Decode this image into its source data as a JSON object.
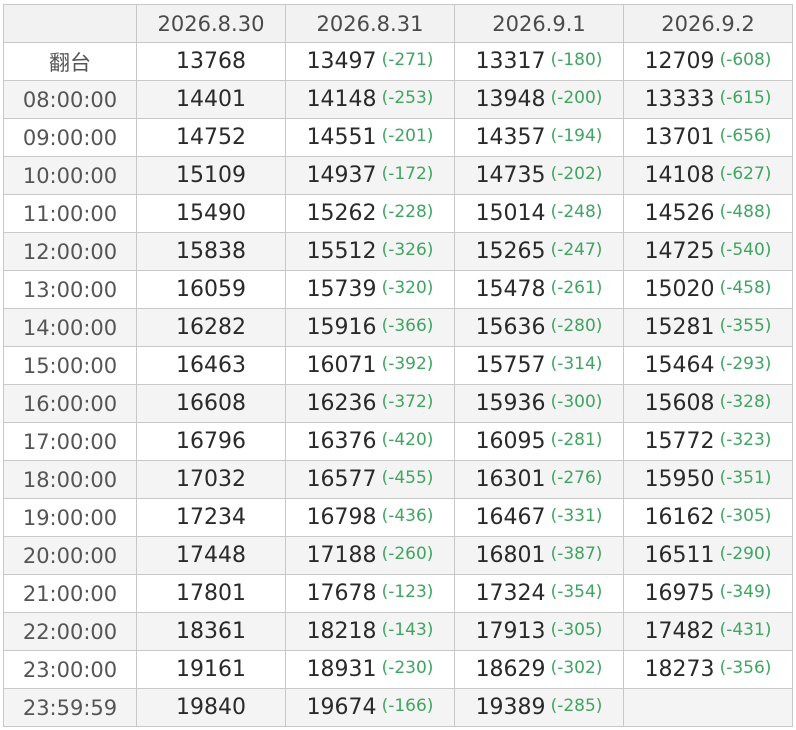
{
  "table": {
    "columns": [
      "",
      "2026.8.30",
      "2026.8.31",
      "2026.9.1",
      "2026.9.2"
    ],
    "rows": [
      {
        "label": "翻台",
        "cells": [
          {
            "value": "13768",
            "diff": ""
          },
          {
            "value": "13497",
            "diff": "(-271)"
          },
          {
            "value": "13317",
            "diff": "(-180)"
          },
          {
            "value": "12709",
            "diff": "(-608)"
          }
        ]
      },
      {
        "label": "08:00:00",
        "cells": [
          {
            "value": "14401",
            "diff": ""
          },
          {
            "value": "14148",
            "diff": "(-253)"
          },
          {
            "value": "13948",
            "diff": "(-200)"
          },
          {
            "value": "13333",
            "diff": "(-615)"
          }
        ]
      },
      {
        "label": "09:00:00",
        "cells": [
          {
            "value": "14752",
            "diff": ""
          },
          {
            "value": "14551",
            "diff": "(-201)"
          },
          {
            "value": "14357",
            "diff": "(-194)"
          },
          {
            "value": "13701",
            "diff": "(-656)"
          }
        ]
      },
      {
        "label": "10:00:00",
        "cells": [
          {
            "value": "15109",
            "diff": ""
          },
          {
            "value": "14937",
            "diff": "(-172)"
          },
          {
            "value": "14735",
            "diff": "(-202)"
          },
          {
            "value": "14108",
            "diff": "(-627)"
          }
        ]
      },
      {
        "label": "11:00:00",
        "cells": [
          {
            "value": "15490",
            "diff": ""
          },
          {
            "value": "15262",
            "diff": "(-228)"
          },
          {
            "value": "15014",
            "diff": "(-248)"
          },
          {
            "value": "14526",
            "diff": "(-488)"
          }
        ]
      },
      {
        "label": "12:00:00",
        "cells": [
          {
            "value": "15838",
            "diff": ""
          },
          {
            "value": "15512",
            "diff": "(-326)"
          },
          {
            "value": "15265",
            "diff": "(-247)"
          },
          {
            "value": "14725",
            "diff": "(-540)"
          }
        ]
      },
      {
        "label": "13:00:00",
        "cells": [
          {
            "value": "16059",
            "diff": ""
          },
          {
            "value": "15739",
            "diff": "(-320)"
          },
          {
            "value": "15478",
            "diff": "(-261)"
          },
          {
            "value": "15020",
            "diff": "(-458)"
          }
        ]
      },
      {
        "label": "14:00:00",
        "cells": [
          {
            "value": "16282",
            "diff": ""
          },
          {
            "value": "15916",
            "diff": "(-366)"
          },
          {
            "value": "15636",
            "diff": "(-280)"
          },
          {
            "value": "15281",
            "diff": "(-355)"
          }
        ]
      },
      {
        "label": "15:00:00",
        "cells": [
          {
            "value": "16463",
            "diff": ""
          },
          {
            "value": "16071",
            "diff": "(-392)"
          },
          {
            "value": "15757",
            "diff": "(-314)"
          },
          {
            "value": "15464",
            "diff": "(-293)"
          }
        ]
      },
      {
        "label": "16:00:00",
        "cells": [
          {
            "value": "16608",
            "diff": ""
          },
          {
            "value": "16236",
            "diff": "(-372)"
          },
          {
            "value": "15936",
            "diff": "(-300)"
          },
          {
            "value": "15608",
            "diff": "(-328)"
          }
        ]
      },
      {
        "label": "17:00:00",
        "cells": [
          {
            "value": "16796",
            "diff": ""
          },
          {
            "value": "16376",
            "diff": "(-420)"
          },
          {
            "value": "16095",
            "diff": "(-281)"
          },
          {
            "value": "15772",
            "diff": "(-323)"
          }
        ]
      },
      {
        "label": "18:00:00",
        "cells": [
          {
            "value": "17032",
            "diff": ""
          },
          {
            "value": "16577",
            "diff": "(-455)"
          },
          {
            "value": "16301",
            "diff": "(-276)"
          },
          {
            "value": "15950",
            "diff": "(-351)"
          }
        ]
      },
      {
        "label": "19:00:00",
        "cells": [
          {
            "value": "17234",
            "diff": ""
          },
          {
            "value": "16798",
            "diff": "(-436)"
          },
          {
            "value": "16467",
            "diff": "(-331)"
          },
          {
            "value": "16162",
            "diff": "(-305)"
          }
        ]
      },
      {
        "label": "20:00:00",
        "cells": [
          {
            "value": "17448",
            "diff": ""
          },
          {
            "value": "17188",
            "diff": "(-260)"
          },
          {
            "value": "16801",
            "diff": "(-387)"
          },
          {
            "value": "16511",
            "diff": "(-290)"
          }
        ]
      },
      {
        "label": "21:00:00",
        "cells": [
          {
            "value": "17801",
            "diff": ""
          },
          {
            "value": "17678",
            "diff": "(-123)"
          },
          {
            "value": "17324",
            "diff": "(-354)"
          },
          {
            "value": "16975",
            "diff": "(-349)"
          }
        ]
      },
      {
        "label": "22:00:00",
        "cells": [
          {
            "value": "18361",
            "diff": ""
          },
          {
            "value": "18218",
            "diff": "(-143)"
          },
          {
            "value": "17913",
            "diff": "(-305)"
          },
          {
            "value": "17482",
            "diff": "(-431)"
          }
        ]
      },
      {
        "label": "23:00:00",
        "cells": [
          {
            "value": "19161",
            "diff": ""
          },
          {
            "value": "18931",
            "diff": "(-230)"
          },
          {
            "value": "18629",
            "diff": "(-302)"
          },
          {
            "value": "18273",
            "diff": "(-356)"
          }
        ]
      },
      {
        "label": "23:59:59",
        "cells": [
          {
            "value": "19840",
            "diff": ""
          },
          {
            "value": "19674",
            "diff": "(-166)"
          },
          {
            "value": "19389",
            "diff": "(-285)"
          },
          {
            "value": "",
            "diff": ""
          }
        ]
      }
    ]
  },
  "colors": {
    "diff_text": "#3fa561",
    "header_bg": "#f2f2f2",
    "stripe_bg": "#f4f4f4",
    "border": "#c8c8c8"
  }
}
